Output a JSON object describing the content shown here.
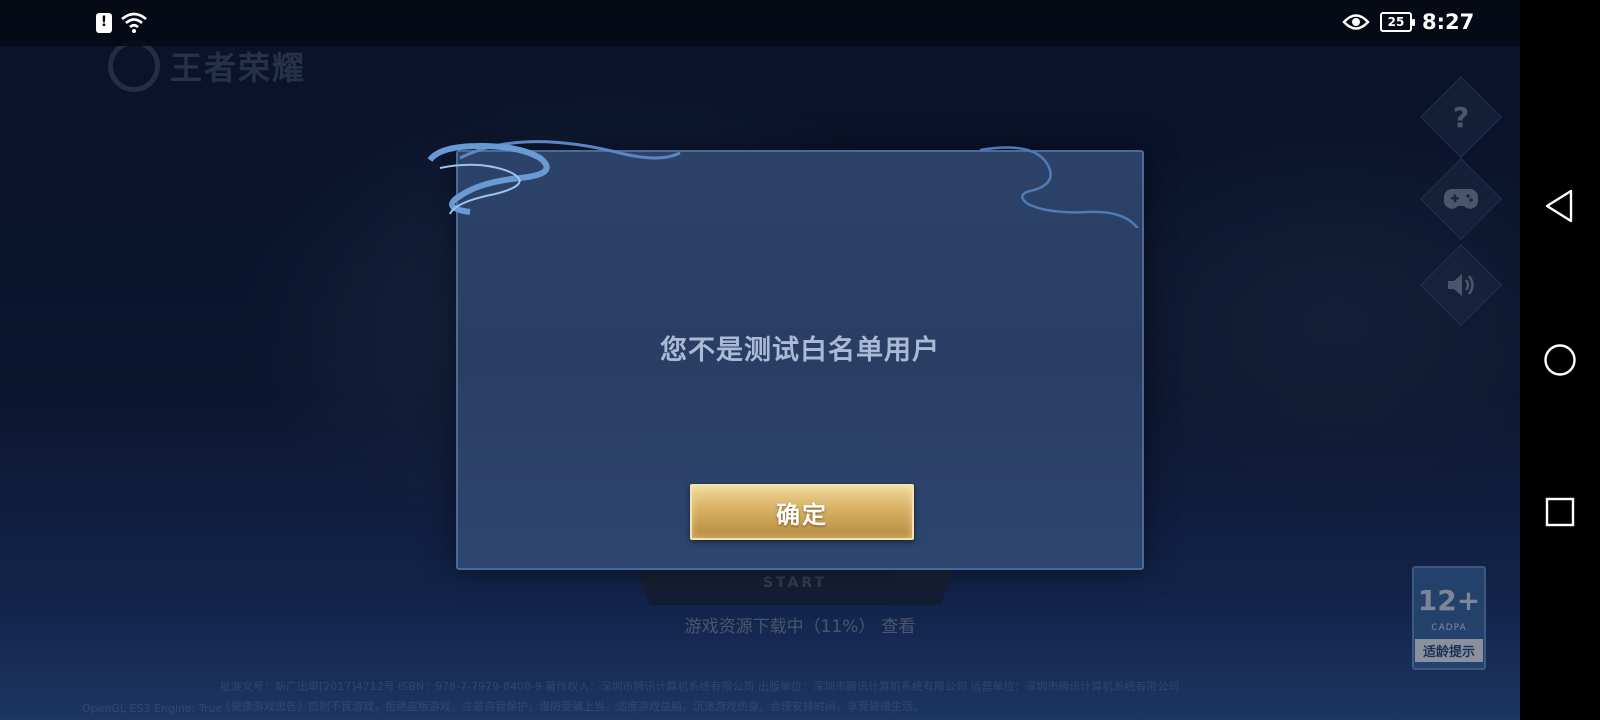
{
  "status_bar": {
    "battery": "25",
    "time": "8:27",
    "icons": [
      "sim-alert-icon",
      "wifi-icon",
      "eye-icon",
      "battery-icon"
    ]
  },
  "game": {
    "logo_text": "王者荣耀",
    "side_buttons": [
      {
        "icon": "help-icon",
        "glyph": "?"
      },
      {
        "icon": "gamepad-icon",
        "glyph": "🎮"
      },
      {
        "icon": "speaker-icon",
        "glyph": "🔊"
      }
    ],
    "start_label": "START",
    "download_status": "游戏资源下载中（11%）",
    "download_progress": 0.11,
    "download_link": "查看",
    "footer_line1": "批准文号：新广出审[2017]4712号  ISBN：978-7-7979-8408-9  著作权人：深圳市腾讯计算机系统有限公司  出版单位：深圳市腾讯计算机系统有限公司  运营单位：深圳市腾讯计算机系统有限公司",
    "footer_line2": "《健康游戏忠告》抵制不良游戏，拒绝盗版游戏。注意自我保护，谨防受骗上当。适度游戏益脑，沉迷游戏伤身。合理安排时间，享受健康生活。",
    "engine_tag": "OpenGL ES3 Engine: True",
    "age_badge": {
      "age": "12+",
      "org": "CADPA",
      "tip": "适龄提示"
    }
  },
  "dialog": {
    "message": "您不是测试白名单用户",
    "confirm_label": "确定"
  },
  "nav_bar": {
    "buttons": [
      "back-icon",
      "home-icon",
      "recents-icon"
    ]
  }
}
